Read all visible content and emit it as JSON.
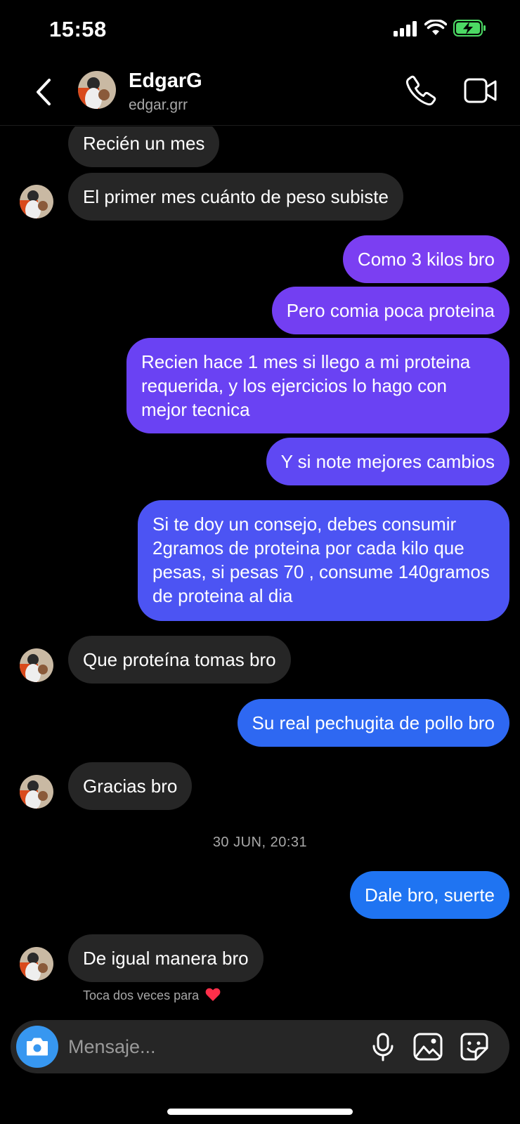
{
  "status_bar": {
    "time": "15:58"
  },
  "header": {
    "name": "EdgarG",
    "username": "edgar.grr"
  },
  "messages": [
    {
      "text": "Recién un mes"
    },
    {
      "text": "El primer mes cuánto de peso subiste"
    },
    {
      "text": "Como 3 kilos bro"
    },
    {
      "text": "Pero comia poca proteina"
    },
    {
      "text": "Recien hace 1 mes si llego a mi proteina requerida, y los ejercicios lo hago con mejor tecnica"
    },
    {
      "text": "Y si note mejores cambios"
    },
    {
      "text": "Si te doy un consejo, debes consumir 2gramos de proteina por cada kilo que pesas, si pesas 70 , consume 140gramos de proteina al dia"
    },
    {
      "text": "Que proteína tomas bro"
    },
    {
      "text": "Su real pechugita de pollo bro"
    },
    {
      "text": "Gracias bro"
    },
    {
      "text": "Dale bro, suerte"
    },
    {
      "text": "De igual manera bro"
    }
  ],
  "timestamp": "30 JUN, 20:31",
  "hint": "Toca dos veces para",
  "hint_icon": "heart-icon",
  "composer": {
    "placeholder": "Mensaje..."
  },
  "colors": {
    "incoming": "#262626",
    "outgoing_purple": "#7a3ff2",
    "outgoing_indigo": "#5a4cf3",
    "outgoing_blue": "#1f74f2",
    "camera": "#3797f0",
    "battery": "#4cd964"
  }
}
